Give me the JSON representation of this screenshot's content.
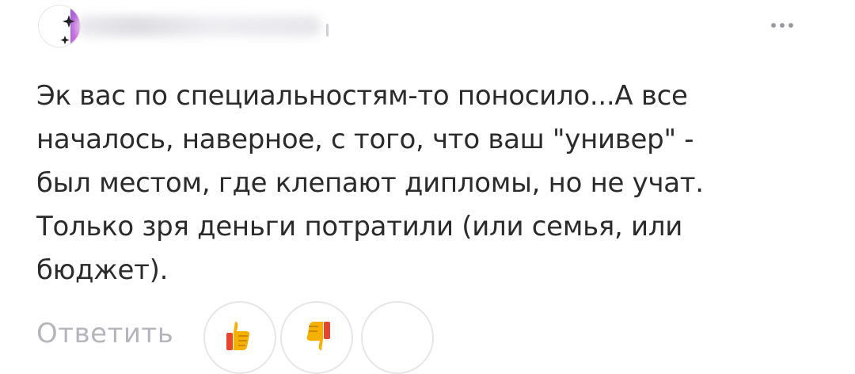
{
  "comment": {
    "text": "Эк вас по специальностям-то поносило...А все\nначалось, наверное, с того, что ваш \"универ\" -\nбыл местом, где клепают дипломы, но не учат.\nТолько зря деньги потратили (или семья, или\nбюджет).",
    "more_icon": "more-dots-icon"
  },
  "footer": {
    "reply_label": "Ответить",
    "reactions": [
      {
        "icon": "thumbs-up-icon"
      },
      {
        "icon": "thumbs-down-icon"
      },
      {
        "icon": "add-reaction-icon"
      }
    ]
  },
  "colors": {
    "text": "#2b2b2b",
    "muted": "#b5b5bb",
    "border": "#e6e6ea",
    "emoji_yellow": "#f5b000",
    "emoji_red": "#e8452f",
    "avatar_accent_purple": "#8a3bd6",
    "avatar_accent_pink": "#e85ad6"
  }
}
